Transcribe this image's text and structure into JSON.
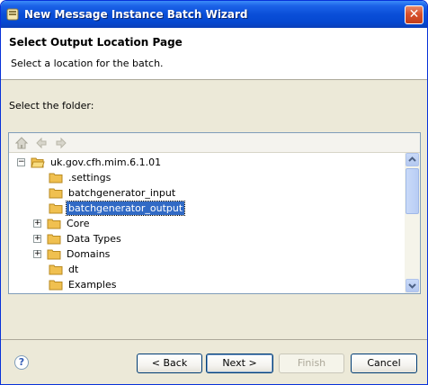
{
  "window": {
    "title": "New Message Instance Batch Wizard",
    "close_label": "✕"
  },
  "header": {
    "title": "Select Output Location Page",
    "description": "Select a location for the batch."
  },
  "folder_label": "Select the folder:",
  "tree": {
    "root": "uk.gov.cfh.mim.6.1.01",
    "items": [
      {
        "label": ".settings"
      },
      {
        "label": "batchgenerator_input"
      },
      {
        "label": "batchgenerator_output"
      },
      {
        "label": "Core"
      },
      {
        "label": "Data Types"
      },
      {
        "label": "Domains"
      },
      {
        "label": "dt"
      },
      {
        "label": "Examples"
      }
    ],
    "selected": "batchgenerator_output"
  },
  "buttons": {
    "back": "< Back",
    "next": "Next >",
    "finish": "Finish",
    "cancel": "Cancel"
  },
  "help_label": "?",
  "colors": {
    "titlebar": "#0a4ed8",
    "selection": "#316ac5",
    "folder": "#f0c050"
  }
}
